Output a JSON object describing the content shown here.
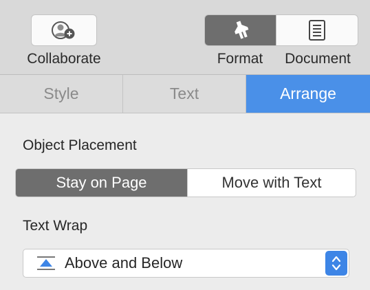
{
  "toolbar": {
    "collaborate_label": "Collaborate",
    "format_label": "Format",
    "document_label": "Document",
    "collaborate_icon": "add-person-icon",
    "format_icon": "paintbrush-icon",
    "document_icon": "document-icon"
  },
  "tabs": [
    {
      "label": "Style",
      "selected": false
    },
    {
      "label": "Text",
      "selected": false
    },
    {
      "label": "Arrange",
      "selected": true
    }
  ],
  "object_placement": {
    "title": "Object Placement",
    "options": [
      {
        "label": "Stay on Page",
        "selected": true
      },
      {
        "label": "Move with Text",
        "selected": false
      }
    ]
  },
  "text_wrap": {
    "title": "Text Wrap",
    "value": "Above and Below",
    "icon": "above-below-wrap-icon"
  },
  "colors": {
    "accent": "#4a90e8",
    "selected_segment": "#6e6e6e",
    "stepper": "#3d85e6"
  }
}
